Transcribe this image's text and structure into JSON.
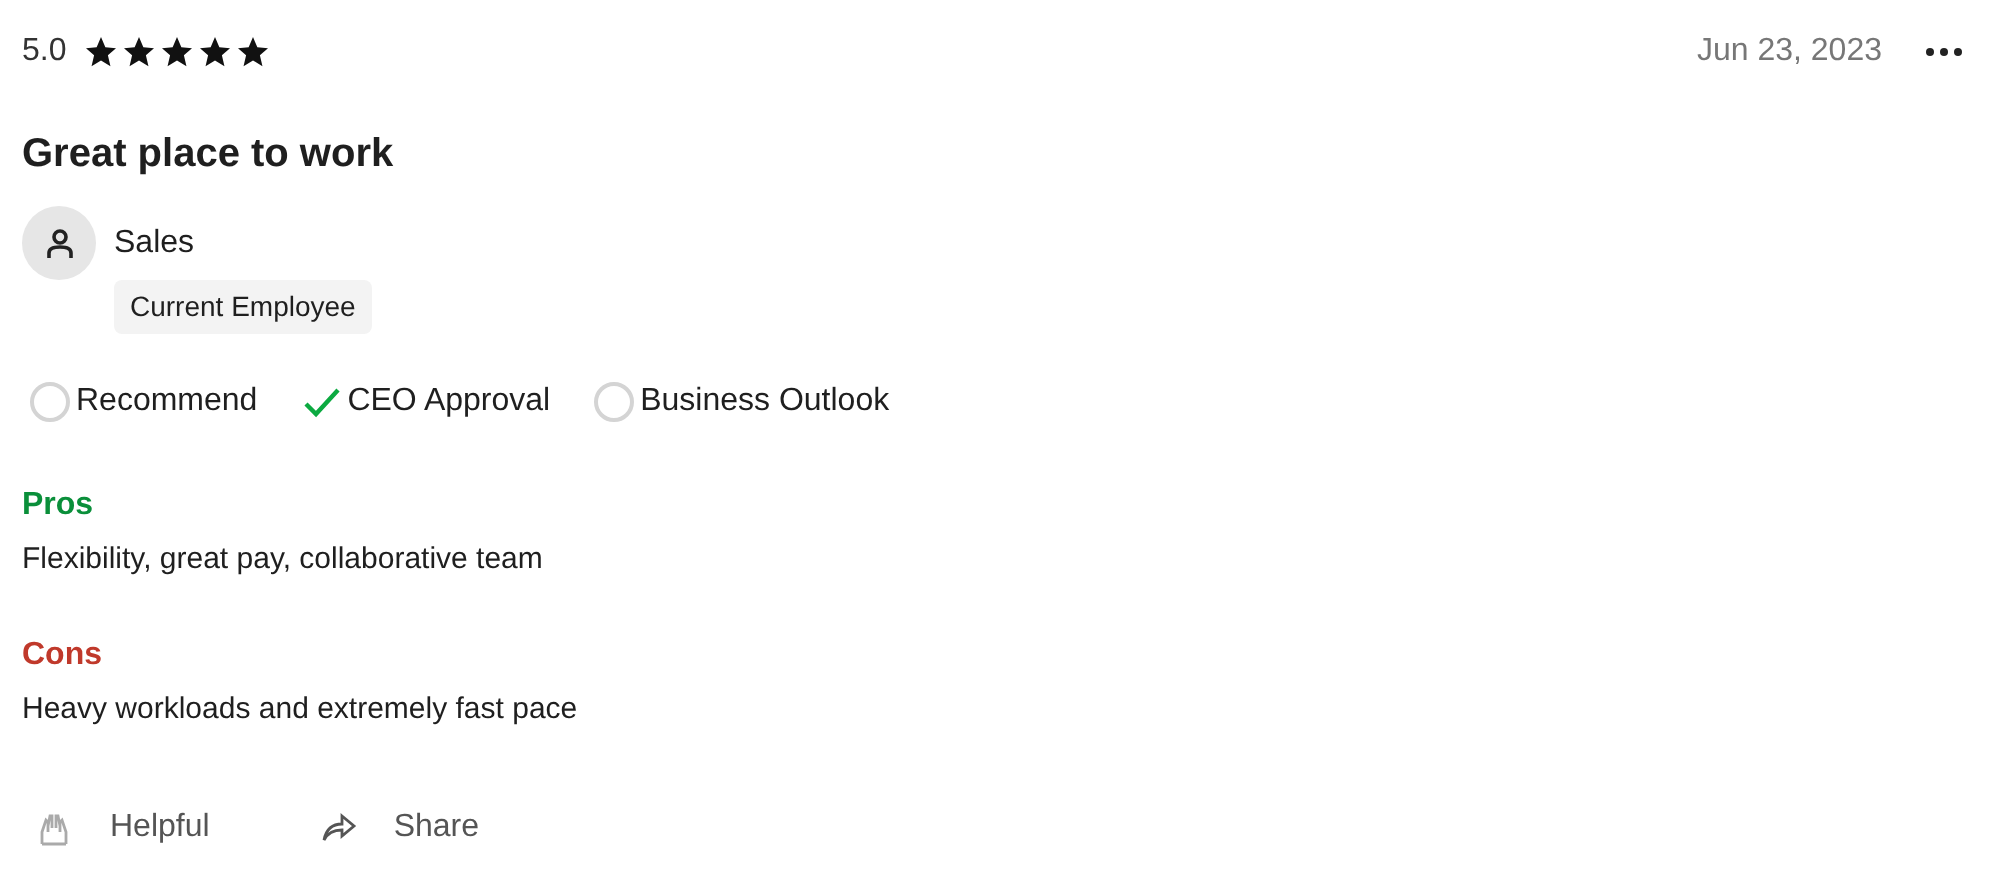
{
  "rating": {
    "score": "5.0",
    "stars": 5
  },
  "date": "Jun 23, 2023",
  "title": "Great place to work",
  "reviewer": {
    "role": "Sales",
    "status": "Current Employee"
  },
  "indicators": [
    {
      "label": "Recommend",
      "kind": "neutral"
    },
    {
      "label": "CEO Approval",
      "kind": "positive"
    },
    {
      "label": "Business Outlook",
      "kind": "neutral"
    }
  ],
  "sections": [
    {
      "heading": "Pros",
      "kind": "pros",
      "text": "Flexibility, great pay, collaborative team"
    },
    {
      "heading": "Cons",
      "kind": "cons",
      "text": "Heavy workloads and extremely fast pace"
    }
  ],
  "actions": [
    {
      "label": "Helpful",
      "kind": "helpful"
    },
    {
      "label": "Share",
      "kind": "share"
    }
  ]
}
